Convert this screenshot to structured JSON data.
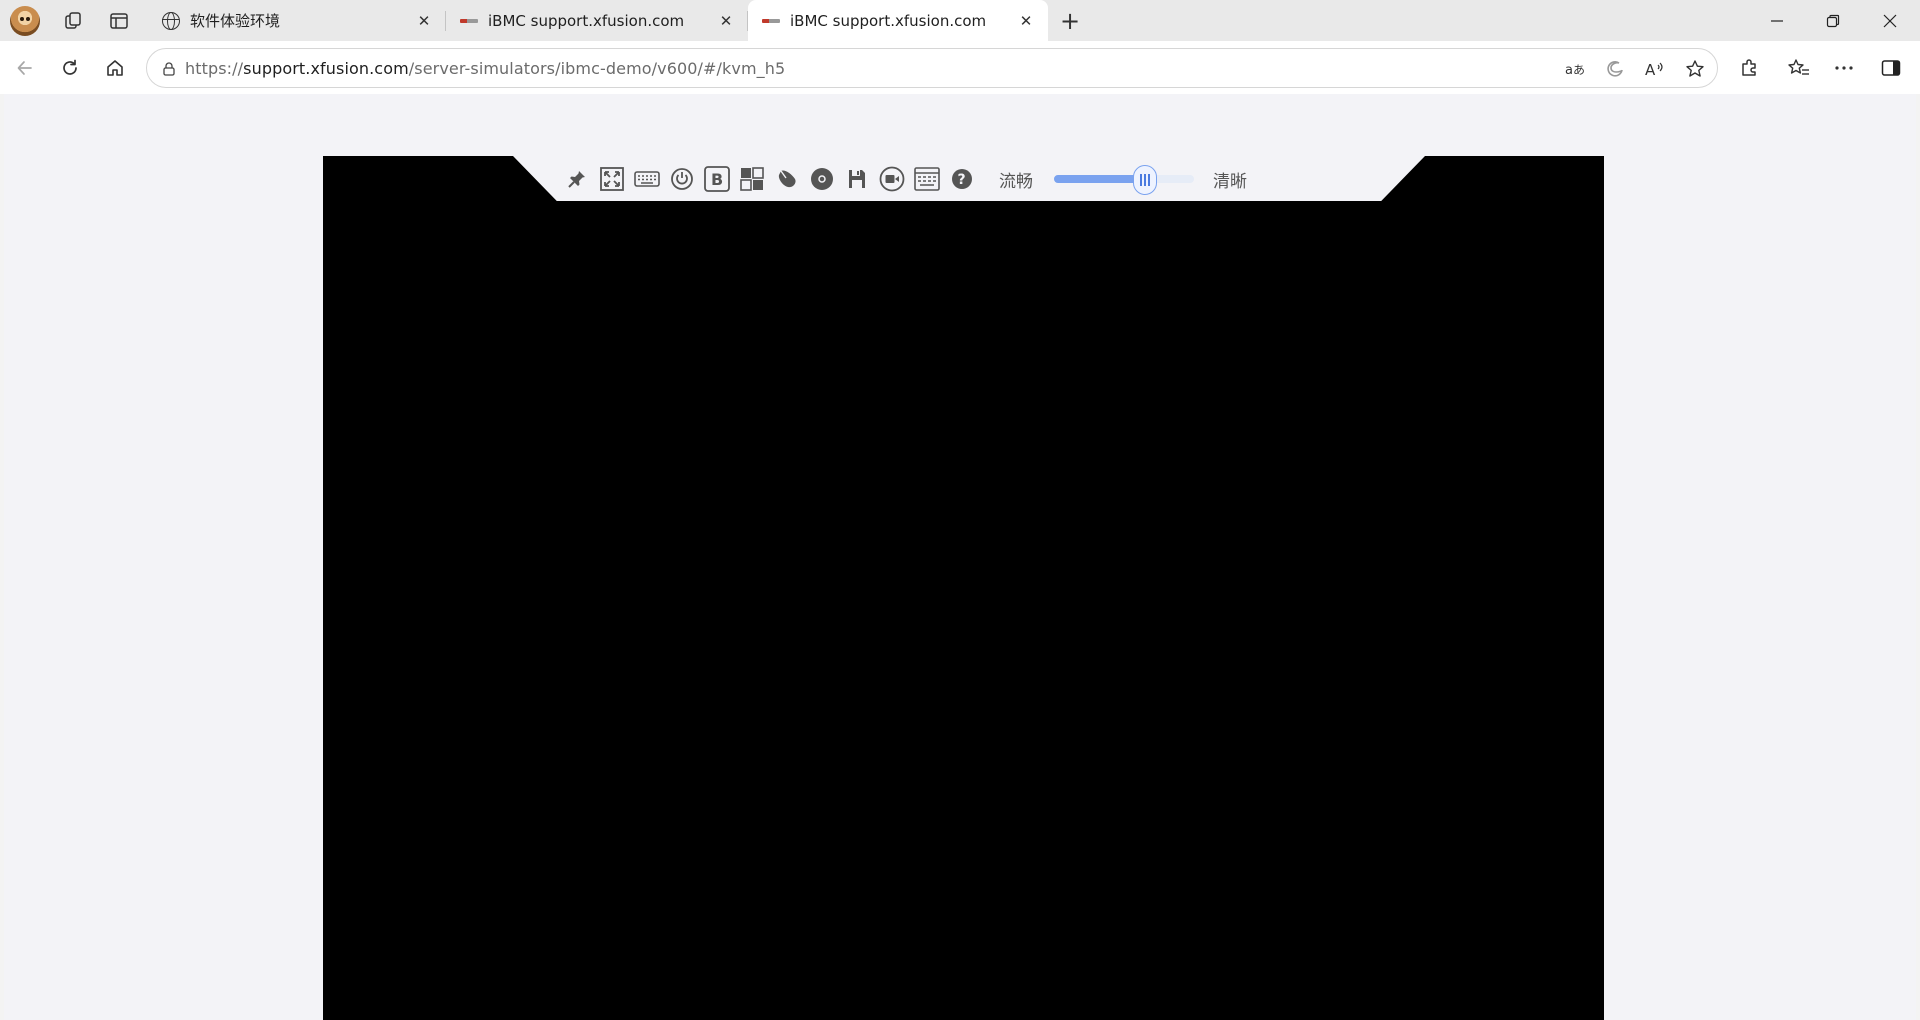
{
  "browser": {
    "tabs": [
      {
        "title": "软件体验环境",
        "favicon": "globe-icon",
        "active": false
      },
      {
        "title": "iBMC support.xfusion.com",
        "favicon": "xfusion-logo",
        "active": false
      },
      {
        "title": "iBMC support.xfusion.com",
        "favicon": "xfusion-logo",
        "active": true
      }
    ],
    "address": {
      "scheme": "https://",
      "host": "support.xfusion.com",
      "path": "/server-simulators/ibmc-demo/v600/#/kvm_h5"
    }
  },
  "kvm": {
    "toolbar_icons": [
      "pin-icon",
      "fullscreen-icon",
      "keyboard-icon",
      "power-icon",
      "boot-icon",
      "mouse-mode-icon",
      "mouse-icon",
      "cd-dvd-icon",
      "floppy-icon",
      "record-icon",
      "virtual-keyboard-icon",
      "help-icon"
    ],
    "quality": {
      "low_label": "流畅",
      "high_label": "清晰",
      "value_percent": 65
    },
    "accent_color": "#7aa2ef"
  }
}
